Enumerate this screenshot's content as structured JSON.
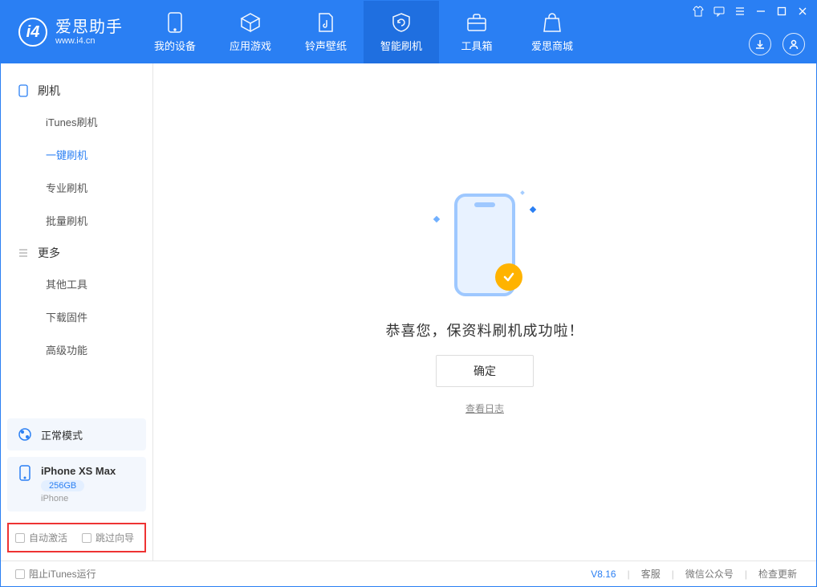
{
  "app": {
    "name_cn": "爱思助手",
    "name_en": "www.i4.cn"
  },
  "top_tabs": [
    {
      "label": "我的设备"
    },
    {
      "label": "应用游戏"
    },
    {
      "label": "铃声壁纸"
    },
    {
      "label": "智能刷机"
    },
    {
      "label": "工具箱"
    },
    {
      "label": "爱思商城"
    }
  ],
  "sidebar": {
    "section_flash": "刷机",
    "items_flash": [
      "iTunes刷机",
      "一键刷机",
      "专业刷机",
      "批量刷机"
    ],
    "section_more": "更多",
    "items_more": [
      "其他工具",
      "下载固件",
      "高级功能"
    ],
    "mode": "正常模式",
    "device": {
      "name": "iPhone XS Max",
      "capacity": "256GB",
      "type": "iPhone"
    },
    "checkbox_auto_activate": "自动激活",
    "checkbox_skip_guide": "跳过向导"
  },
  "main": {
    "success_message": "恭喜您，保资料刷机成功啦！",
    "ok_button": "确定",
    "view_log": "查看日志"
  },
  "footer": {
    "block_itunes": "阻止iTunes运行",
    "version": "V8.16",
    "links": [
      "客服",
      "微信公众号",
      "检查更新"
    ]
  }
}
